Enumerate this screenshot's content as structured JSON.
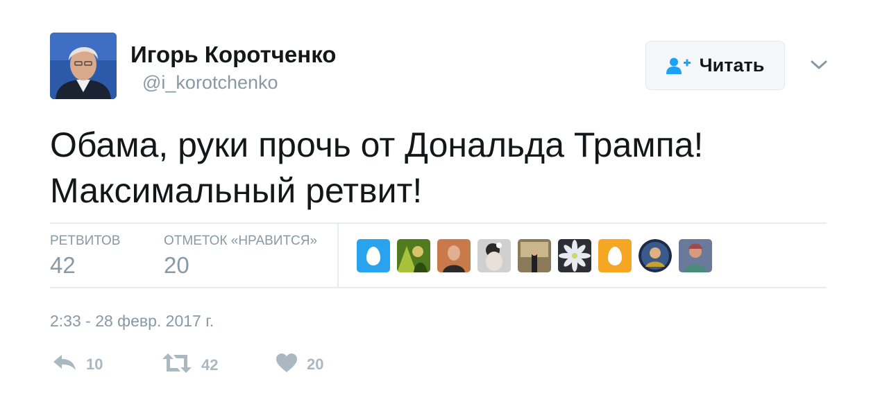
{
  "user": {
    "name": "Игорь Коротченко",
    "handle": "@i_korotchenko",
    "avatar_icon": "profile-photo"
  },
  "follow_button": {
    "label": "Читать",
    "icon": "follow-user-icon"
  },
  "menu": {
    "icon": "chevron-down-icon"
  },
  "tweet": {
    "lines": [
      "Обама, руки прочь от Дональда Трампа!",
      "Максимальный ретвит!"
    ]
  },
  "stats": {
    "retweets": {
      "label": "РЕТВИТОВ",
      "value": "42"
    },
    "likes": {
      "label": "ОТМЕТОК «НРАВИТСЯ»",
      "value": "20"
    }
  },
  "likers": [
    {
      "type": "egg",
      "color": "#2aa3ef"
    },
    {
      "type": "photo",
      "color": "#6a8a2a"
    },
    {
      "type": "photo",
      "color": "#b5694a"
    },
    {
      "type": "photo",
      "color": "#c8c8c8"
    },
    {
      "type": "photo",
      "color": "#6d5a3a"
    },
    {
      "type": "photo",
      "color": "#3a3a45"
    },
    {
      "type": "egg",
      "color": "#f5a623"
    },
    {
      "type": "photo-round",
      "color": "#2f3f6a"
    },
    {
      "type": "photo",
      "color": "#5a6a8a"
    }
  ],
  "timestamp": "2:33 - 28 февр. 2017 г.",
  "actions": {
    "reply": {
      "count": "10",
      "icon": "reply-icon"
    },
    "retweet": {
      "count": "42",
      "icon": "retweet-icon"
    },
    "like": {
      "count": "20",
      "icon": "heart-icon"
    }
  },
  "colors": {
    "muted": "#8899a6",
    "action": "#aab8c2",
    "follow_icon": "#1da1f2",
    "divider": "#e6ecf0"
  }
}
